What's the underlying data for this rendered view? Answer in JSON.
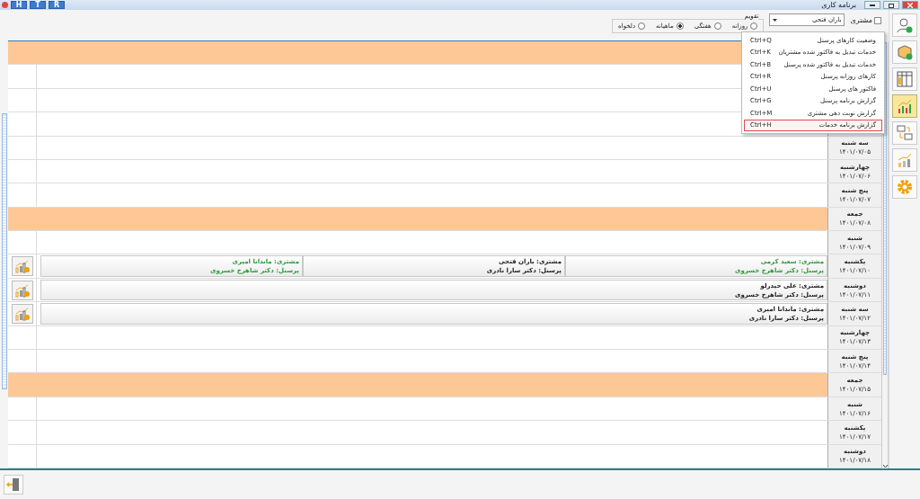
{
  "window": {
    "title": "برنامه کاری",
    "quick_buttons": [
      "R",
      "T",
      "H"
    ]
  },
  "filter": {
    "customer_label": "مشتری",
    "customer_checked": false,
    "customer_value": "باران فتحی",
    "calendar_label": "تقویم",
    "views": [
      {
        "label": "روزانه",
        "selected": false
      },
      {
        "label": "هفتگی",
        "selected": false
      },
      {
        "label": "ماهیانه",
        "selected": true
      },
      {
        "label": "دلخواه",
        "selected": false
      }
    ]
  },
  "toolbar": [
    {
      "kind": "person-add",
      "selected": false
    },
    {
      "kind": "box-add",
      "selected": false
    },
    {
      "kind": "table",
      "selected": false
    },
    {
      "kind": "chart",
      "selected": true
    },
    {
      "kind": "transfer",
      "selected": false
    },
    {
      "kind": "growth",
      "selected": false
    },
    {
      "kind": "gear",
      "selected": false
    }
  ],
  "menu": [
    {
      "label": "وضعیت کارهای پرسنل",
      "shortcut": "Ctrl+Q",
      "selected": false
    },
    {
      "label": "خدمات تبدیل به فاکتور شده مشتریان",
      "shortcut": "Ctrl+K",
      "selected": false
    },
    {
      "label": "خدمات تبدیل به فاکتور شده پرسنل",
      "shortcut": "Ctrl+B",
      "selected": false
    },
    {
      "label": "کارهای روزانه پرسنل",
      "shortcut": "Ctrl+R",
      "selected": false
    },
    {
      "label": "فاکتور های پرسنل",
      "shortcut": "Ctrl+U",
      "selected": false
    },
    {
      "label": "گزارش برنامه پرسنل",
      "shortcut": "Ctrl+G",
      "selected": false
    },
    {
      "label": "گزارش نوبت دهی مشتری",
      "shortcut": "Ctrl+M",
      "selected": false
    },
    {
      "label": "گزارش برنامه خدمات",
      "shortcut": "Ctrl+H",
      "selected": true
    }
  ],
  "days": [
    {
      "holiday": true
    },
    {
      "holiday": false
    },
    {
      "holiday": false
    },
    {
      "holiday": false
    },
    {
      "day": "سه شنبه",
      "date": "۱۴۰۱/۰۷/۰۵",
      "holiday": false
    },
    {
      "day": "چهارشنبه",
      "date": "۱۴۰۱/۰۷/۰۶",
      "holiday": false
    },
    {
      "day": "پنج شنبه",
      "date": "۱۴۰۱/۰۷/۰۷",
      "holiday": false
    },
    {
      "day": "جمعه",
      "date": "۱۴۰۱/۰۷/۰۸",
      "holiday": true
    },
    {
      "day": "شنبه",
      "date": "۱۴۰۱/۰۷/۰۹",
      "holiday": false
    },
    {
      "day": "یکشنبه",
      "date": "۱۴۰۱/۰۷/۱۰",
      "holiday": false,
      "events": [
        {
          "customer": "مشتری: سعید کرمی",
          "staff": "پرسنل: دکتر شاهرخ خسروی",
          "color": "#2f9a3c"
        },
        {
          "customer": "مشتری: باران فتحی",
          "staff": "پرسنل: دکتر سارا نادری",
          "color": "#222222"
        },
        {
          "customer": "مشتری: ماندانا امیری",
          "staff": "پرسنل: دکتر شاهرخ خسروی",
          "color": "#2f9a3c"
        }
      ]
    },
    {
      "day": "دوشنبه",
      "date": "۱۴۰۱/۰۷/۱۱",
      "holiday": false,
      "events": [
        {
          "customer": "مشتری: علی حیدرلو",
          "staff": "پرسنل: دکتر شاهرخ خسروی",
          "color": "#222222"
        }
      ]
    },
    {
      "day": "سه شنبه",
      "date": "۱۴۰۱/۰۷/۱۲",
      "holiday": false,
      "events": [
        {
          "customer": "مشتری: ماندانا امیری",
          "staff": "پرسنل: دکتر سارا نادری",
          "color": "#222222"
        }
      ]
    },
    {
      "day": "چهارشنبه",
      "date": "۱۴۰۱/۰۷/۱۳",
      "holiday": false
    },
    {
      "day": "پنج شنبه",
      "date": "۱۴۰۱/۰۷/۱۴",
      "holiday": false
    },
    {
      "day": "جمعه",
      "date": "۱۴۰۱/۰۷/۱۵",
      "holiday": true
    },
    {
      "day": "شنبه",
      "date": "۱۴۰۱/۰۷/۱۶",
      "holiday": false
    },
    {
      "day": "یکشنبه",
      "date": "۱۴۰۱/۰۷/۱۷",
      "holiday": false
    },
    {
      "day": "دوشنبه",
      "date": "۱۴۰۱/۰۷/۱۸",
      "holiday": false
    }
  ]
}
